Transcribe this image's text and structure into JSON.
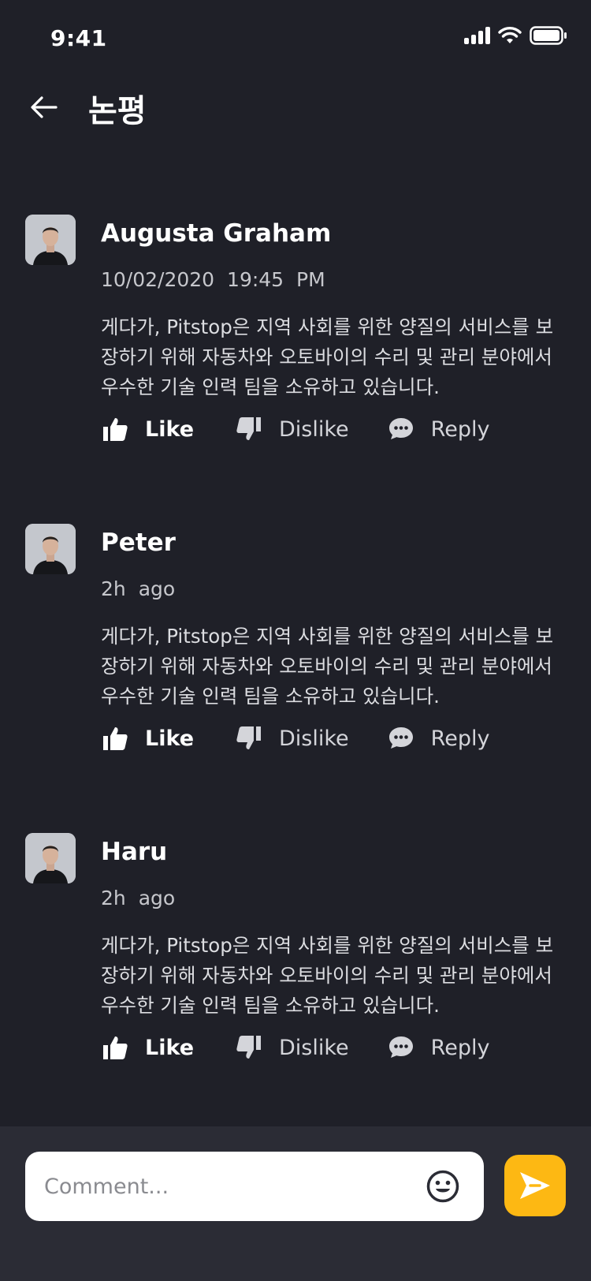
{
  "status_bar": {
    "time": "9:41"
  },
  "header": {
    "title": "논평"
  },
  "comments": [
    {
      "author": "Augusta Graham",
      "time": "10/02/2020   19:45 PM",
      "body": "게다가, Pitstop은 지역 사회를 위한 양질의 서비스를 보장하기 위해 자동차와 오토바이의 수리 및 관리 분야에서 우수한 기술 인력 팀을 소유하고 있습니다.",
      "like_label": "Like",
      "dislike_label": "Dislike",
      "reply_label": "Reply"
    },
    {
      "author": "Peter",
      "time": "2h ago",
      "body": "게다가, Pitstop은 지역 사회를 위한 양질의 서비스를 보장하기 위해 자동차와 오토바이의 수리 및 관리 분야에서 우수한 기술 인력 팀을 소유하고 있습니다.",
      "like_label": "Like",
      "dislike_label": "Dislike",
      "reply_label": "Reply"
    },
    {
      "author": "Haru",
      "time": "2h ago",
      "body": "게다가, Pitstop은 지역 사회를 위한 양질의 서비스를 보장하기 위해 자동차와 오토바이의 수리 및 관리 분야에서 우수한 기술 인력 팀을 소유하고 있습니다.",
      "like_label": "Like",
      "dislike_label": "Dislike",
      "reply_label": "Reply"
    }
  ],
  "composer": {
    "placeholder": "Comment...",
    "emoji_icon": "smiley-icon",
    "send_icon": "send-icon"
  },
  "colors": {
    "background": "#1f2028",
    "composer_bar": "#2b2c35",
    "accent": "#fdb813"
  }
}
